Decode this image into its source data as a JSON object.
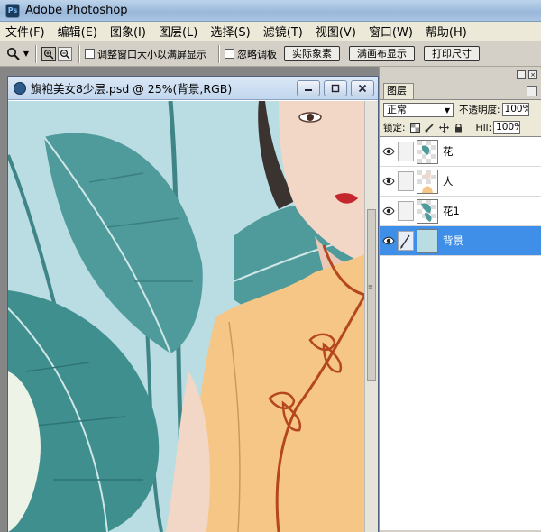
{
  "app": {
    "title": "Adobe Photoshop",
    "logo_text": "Ps"
  },
  "menu": [
    "文件(F)",
    "编辑(E)",
    "图象(I)",
    "图层(L)",
    "选择(S)",
    "滤镜(T)",
    "视图(V)",
    "窗口(W)",
    "帮助(H)"
  ],
  "options": {
    "resize_windows_label": "调整窗口大小以满屏显示",
    "ignore_palettes_label": "忽略调板",
    "actual_pixels": "实际象素",
    "fit_on_screen": "满画布显示",
    "print_size": "打印尺寸"
  },
  "document": {
    "title": "旗袍美女8少层.psd @ 25%(背景,RGB)"
  },
  "layers_panel": {
    "tab": "图层",
    "blend_mode": "正常",
    "opacity_label": "不透明度:",
    "opacity_value": "100%",
    "lock_label": "锁定:",
    "fill_label": "Fill:",
    "fill_value": "100%",
    "layers": [
      {
        "name": "花",
        "selected": false
      },
      {
        "name": "人",
        "selected": false
      },
      {
        "name": "花1",
        "selected": false
      },
      {
        "name": "背景",
        "selected": true
      }
    ]
  },
  "colors": {
    "canvas_bg": "#b9dde3",
    "leaf": "#4f9a9b",
    "dress": "#f6c687",
    "dress_trim": "#b4471e",
    "selected_layer": "#3f8fe8"
  }
}
